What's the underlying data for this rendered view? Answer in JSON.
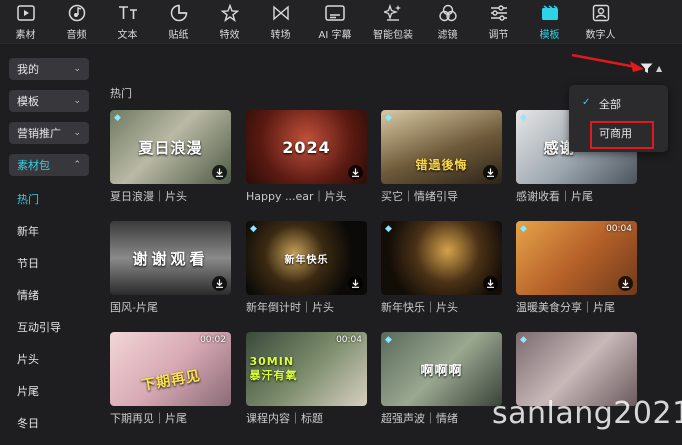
{
  "toolbar": {
    "items": [
      {
        "label": "素材",
        "icon": "media-icon"
      },
      {
        "label": "音频",
        "icon": "audio-icon"
      },
      {
        "label": "文本",
        "icon": "text-icon"
      },
      {
        "label": "贴纸",
        "icon": "sticker-icon"
      },
      {
        "label": "特效",
        "icon": "effects-icon"
      },
      {
        "label": "转场",
        "icon": "transition-icon"
      },
      {
        "label": "AI 字幕",
        "icon": "ai-subtitle-icon"
      },
      {
        "label": "智能包装",
        "icon": "smart-pack-icon"
      },
      {
        "label": "滤镜",
        "icon": "filter-icon"
      },
      {
        "label": "调节",
        "icon": "adjust-icon"
      },
      {
        "label": "模板",
        "icon": "template-icon"
      },
      {
        "label": "数字人",
        "icon": "digital-human-icon"
      }
    ],
    "active": "模板",
    "accent": "#2fd3e8"
  },
  "sidebar": {
    "buttons": [
      {
        "label": "我的"
      },
      {
        "label": "模板"
      },
      {
        "label": "营销推广"
      },
      {
        "label": "素材包"
      }
    ],
    "items": [
      "热门",
      "新年",
      "节日",
      "情绪",
      "互动引导",
      "片头",
      "片尾",
      "冬日"
    ]
  },
  "section": {
    "title": "热门"
  },
  "filter": {
    "options": [
      "全部",
      "可商用"
    ],
    "selected": "全部",
    "highlight_color": "#e0191f"
  },
  "cards": [
    {
      "caption": "夏日浪漫｜片头",
      "thumb_text": "夏日浪漫",
      "premium": true,
      "duration": ""
    },
    {
      "caption": "Happy ...ear｜片头",
      "thumb_text": "2024",
      "premium": false,
      "duration": ""
    },
    {
      "caption": "买它｜情绪引导",
      "thumb_text": "错過後悔",
      "premium": true,
      "duration": ""
    },
    {
      "caption": "感谢收看｜片尾",
      "thumb_text": "感谢",
      "premium": true,
      "duration": ""
    },
    {
      "caption": "国风-片尾",
      "thumb_text": "谢谢观看",
      "premium": false,
      "duration": ""
    },
    {
      "caption": "新年倒计时｜片头",
      "thumb_text": "新年快乐",
      "premium": true,
      "duration": ""
    },
    {
      "caption": "新年快乐｜片头",
      "thumb_text": "",
      "premium": true,
      "duration": ""
    },
    {
      "caption": "温暖美食分享｜片尾",
      "thumb_text": "",
      "premium": true,
      "duration": "00:04"
    },
    {
      "caption": "下期再见｜片尾",
      "thumb_text": "下期再见",
      "premium": false,
      "duration": "00:02"
    },
    {
      "caption": "课程内容｜标题",
      "thumb_text": "30MIN 暴汗有氧",
      "premium": false,
      "duration": "00:04"
    },
    {
      "caption": "超强声波｜情绪",
      "thumb_text": "啊啊啊",
      "premium": true,
      "duration": ""
    },
    {
      "caption": "",
      "thumb_text": "",
      "premium": true,
      "duration": ""
    }
  ],
  "watermark": "sanlang2021"
}
